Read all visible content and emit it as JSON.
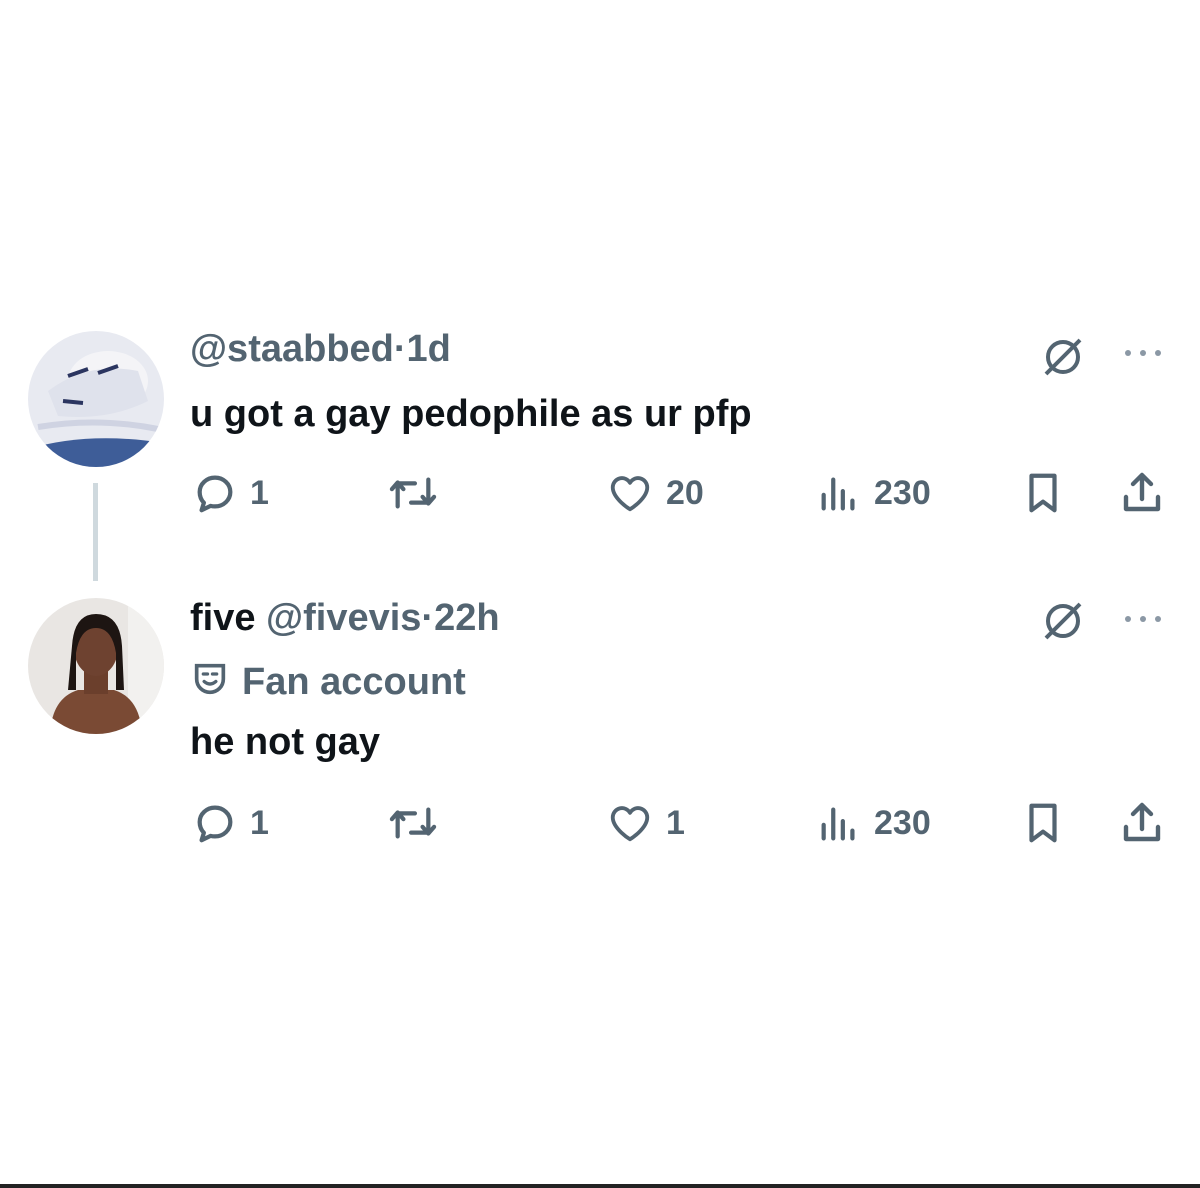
{
  "tweets": [
    {
      "name": "",
      "handle": "@staabbed",
      "separator": "·",
      "time": "1d",
      "label": "",
      "text": "u got a gay pedophile as ur pfp",
      "replies": "1",
      "reposts": "",
      "likes": "20",
      "views": "230"
    },
    {
      "name": "five",
      "handle": "@fivevis",
      "separator": "·",
      "time": "22h",
      "label": "Fan account",
      "text": "he not gay",
      "replies": "1",
      "reposts": "",
      "likes": "1",
      "views": "230"
    }
  ],
  "icons": {
    "reply": "reply-icon",
    "repost": "repost-icon",
    "like": "heart-icon",
    "views": "views-icon",
    "bookmark": "bookmark-icon",
    "share": "share-icon",
    "grok": "grok-icon",
    "more": "more-icon",
    "label": "theater-masks-icon"
  },
  "colors": {
    "text": "#0f1419",
    "secondary": "#536471",
    "thread_line": "#cfd9de",
    "background": "#ffffff"
  }
}
